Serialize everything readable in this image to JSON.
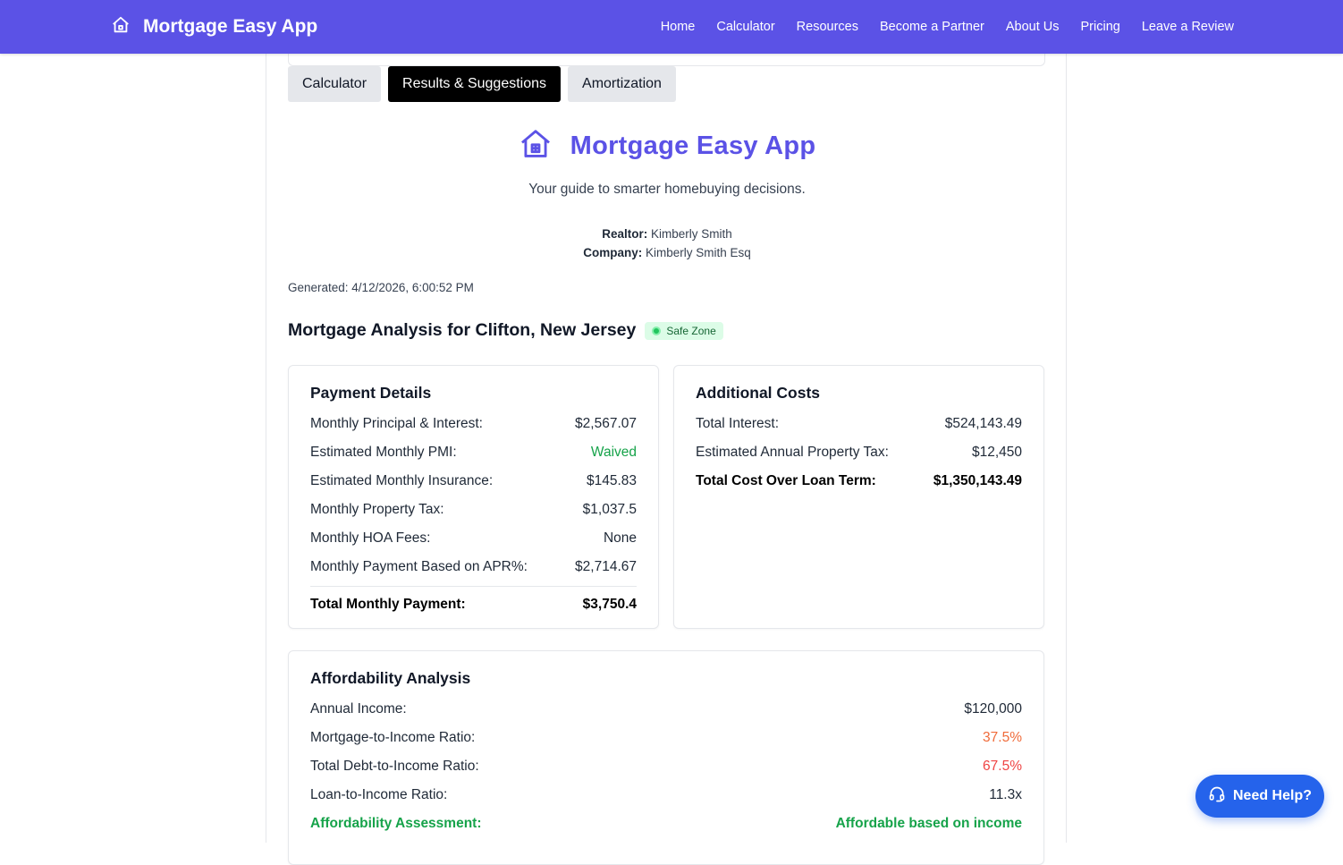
{
  "navbar": {
    "brand": "Mortgage Easy App",
    "links": [
      "Home",
      "Calculator",
      "Resources",
      "Become a Partner",
      "About Us",
      "Pricing",
      "Leave a Review"
    ]
  },
  "tabs": [
    {
      "label": "Calculator",
      "active": false
    },
    {
      "label": "Results & Suggestions",
      "active": true
    },
    {
      "label": "Amortization",
      "active": false
    }
  ],
  "hero": {
    "title": "Mortgage Easy App",
    "subtitle": "Your guide to smarter homebuying decisions.",
    "realtor_label": "Realtor:",
    "realtor_value": "Kimberly Smith",
    "company_label": "Company:",
    "company_value": "Kimberly Smith Esq"
  },
  "generated": "Generated: 4/12/2026, 6:00:52 PM",
  "analysis": {
    "title": "Mortgage Analysis for Clifton, New Jersey",
    "badge": "Safe Zone"
  },
  "payment_details": {
    "title": "Payment Details",
    "rows": [
      {
        "label": "Monthly Principal & Interest:",
        "value": "$2,567.07"
      },
      {
        "label": "Estimated Monthly PMI:",
        "value": "Waived"
      },
      {
        "label": "Estimated Monthly Insurance:",
        "value": "$145.83"
      },
      {
        "label": "Monthly Property Tax:",
        "value": "$1,037.5"
      },
      {
        "label": "Monthly HOA Fees:",
        "value": "None"
      },
      {
        "label": "Monthly Payment Based on APR%:",
        "value": "$2,714.67"
      }
    ],
    "total_label": "Total Monthly Payment:",
    "total_value": "$3,750.4"
  },
  "additional_costs": {
    "title": "Additional Costs",
    "rows": [
      {
        "label": "Total Interest:",
        "value": "$524,143.49"
      },
      {
        "label": "Estimated Annual Property Tax:",
        "value": "$12,450"
      }
    ],
    "total_label": "Total Cost Over Loan Term:",
    "total_value": "$1,350,143.49"
  },
  "affordability": {
    "title": "Affordability Analysis",
    "rows": [
      {
        "label": "Annual Income:",
        "value": "$120,000"
      },
      {
        "label": "Mortgage-to-Income Ratio:",
        "value": "37.5%"
      },
      {
        "label": "Total Debt-to-Income Ratio:",
        "value": "67.5%"
      },
      {
        "label": "Loan-to-Income Ratio:",
        "value": "11.3x"
      }
    ],
    "assessment_label": "Affordability Assessment:",
    "assessment_value": "Affordable based on income"
  },
  "help_button": "Need Help?",
  "colors": {
    "brand": "#5b52e6",
    "positive": "#16a34a",
    "warning": "#f06b3a",
    "danger": "#ef4444",
    "help": "#2563eb"
  },
  "icons": {
    "nav_brand": "house-icon",
    "hero": "house-icon",
    "badge": "status-dot-icon",
    "help": "headset-icon"
  }
}
